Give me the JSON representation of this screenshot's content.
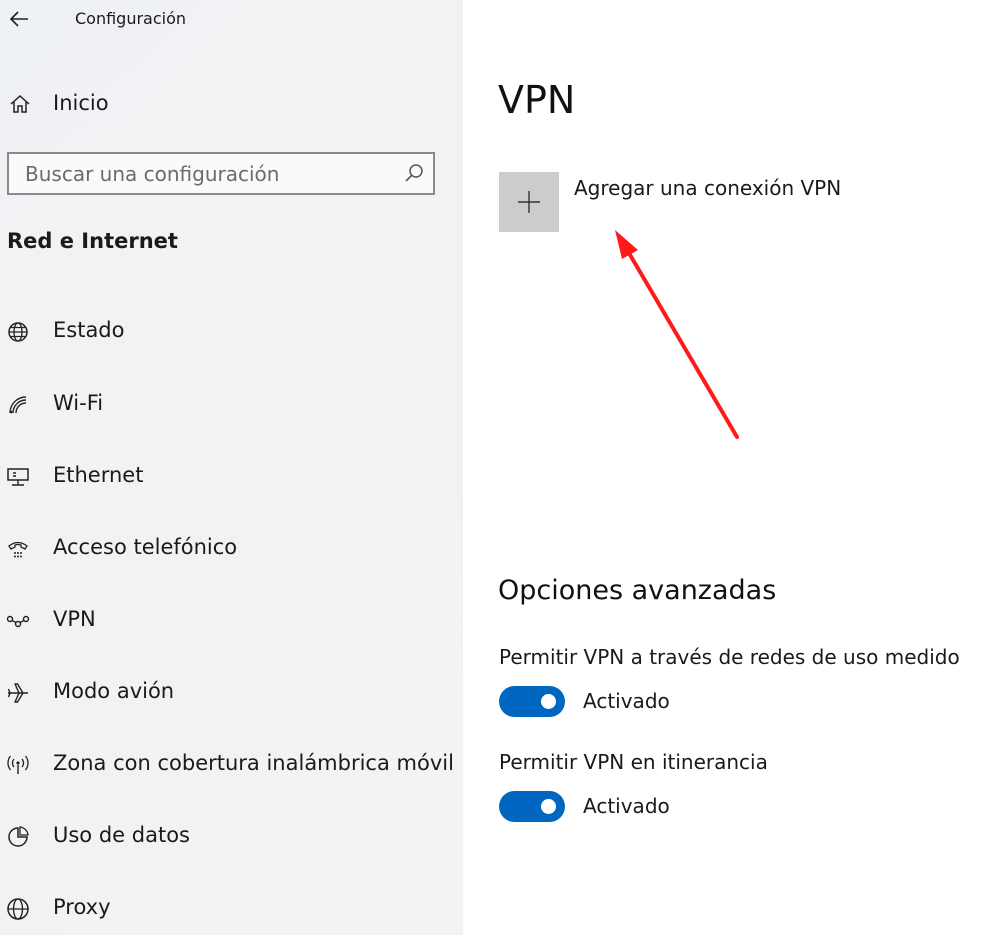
{
  "window": {
    "title": "Configuración"
  },
  "sidebar": {
    "home_label": "Inicio",
    "search": {
      "placeholder": "Buscar una configuración",
      "value": ""
    },
    "section_title": "Red e Internet",
    "items": [
      {
        "label": "Estado",
        "icon": "globe-status-icon"
      },
      {
        "label": "Wi-Fi",
        "icon": "wifi-icon"
      },
      {
        "label": "Ethernet",
        "icon": "ethernet-icon"
      },
      {
        "label": "Acceso telefónico",
        "icon": "dialup-phone-icon"
      },
      {
        "label": "VPN",
        "icon": "vpn-icon"
      },
      {
        "label": "Modo avión",
        "icon": "airplane-icon"
      },
      {
        "label": "Zona con cobertura inalámbrica móvil",
        "icon": "hotspot-icon"
      },
      {
        "label": "Uso de datos",
        "icon": "data-usage-icon"
      },
      {
        "label": "Proxy",
        "icon": "globe-proxy-icon"
      }
    ]
  },
  "main": {
    "title": "VPN",
    "add_connection_label": "Agregar una conexión VPN",
    "advanced": {
      "title": "Opciones avanzadas",
      "options": [
        {
          "label": "Permitir VPN a través de redes de uso medido",
          "state": "Activado",
          "on": true
        },
        {
          "label": "Permitir VPN en itinerancia",
          "state": "Activado",
          "on": true
        }
      ]
    }
  },
  "colors": {
    "accent": "#0067c0",
    "annotation": "#ff1a1a",
    "tile": "#cccccc"
  }
}
